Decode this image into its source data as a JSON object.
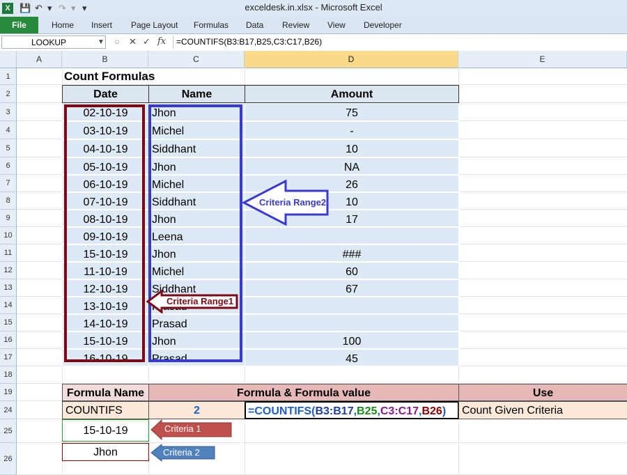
{
  "window": {
    "title": "exceldesk.in.xlsx  -  Microsoft Excel"
  },
  "ribbon": {
    "file": "File",
    "tabs": [
      "Home",
      "Insert",
      "Page Layout",
      "Formulas",
      "Data",
      "Review",
      "View",
      "Developer"
    ]
  },
  "formula_bar": {
    "name_box": "LOOKUP",
    "fx": "fx",
    "formula": "=COUNTIFS(B3:B17,B25,C3:C17,B26)"
  },
  "columns": [
    "A",
    "B",
    "C",
    "D",
    "E"
  ],
  "rows": [
    "1",
    "2",
    "3",
    "4",
    "5",
    "6",
    "7",
    "8",
    "9",
    "10",
    "11",
    "12",
    "13",
    "14",
    "15",
    "16",
    "17",
    "18",
    "19",
    "24",
    "25",
    "26"
  ],
  "sheet": {
    "title": "Count Formulas",
    "headers": {
      "date": "Date",
      "name": "Name",
      "amount": "Amount"
    },
    "records": [
      {
        "date": "02-10-19",
        "name": "Jhon",
        "amount": "75"
      },
      {
        "date": "03-10-19",
        "name": "Michel",
        "amount": "-"
      },
      {
        "date": "04-10-19",
        "name": "Siddhant",
        "amount": "10"
      },
      {
        "date": "05-10-19",
        "name": "Jhon",
        "amount": "NA"
      },
      {
        "date": "06-10-19",
        "name": "Michel",
        "amount": "26"
      },
      {
        "date": "07-10-19",
        "name": "Siddhant",
        "amount": "10"
      },
      {
        "date": "08-10-19",
        "name": "Jhon",
        "amount": "17"
      },
      {
        "date": "09-10-19",
        "name": "Leena",
        "amount": ""
      },
      {
        "date": "15-10-19",
        "name": "Jhon",
        "amount": "###"
      },
      {
        "date": "11-10-19",
        "name": "Michel",
        "amount": "60"
      },
      {
        "date": "12-10-19",
        "name": "Siddhant",
        "amount": "67"
      },
      {
        "date": "13-10-19",
        "name": "Prasad",
        "amount": ""
      },
      {
        "date": "14-10-19",
        "name": "Prasad",
        "amount": ""
      },
      {
        "date": "15-10-19",
        "name": "Jhon",
        "amount": "100"
      },
      {
        "date": "16-10-19",
        "name": "Prasad",
        "amount": "45"
      }
    ],
    "summary_headers": {
      "formula_name": "Formula Name",
      "formula_value": "Formula & Formula value",
      "use": "Use"
    },
    "summary_row": {
      "name": "COUNTIFS",
      "value": "2",
      "use": "Count Given Criteria"
    },
    "formula_parts": [
      {
        "text": "=COUNTIFS(",
        "color": "#1f5fc0"
      },
      {
        "text": "B3:B17",
        "color": "#1f3fa0"
      },
      {
        "text": ",",
        "color": "#1f5fc0"
      },
      {
        "text": "B25",
        "color": "#1a8a1a"
      },
      {
        "text": ",",
        "color": "#1f5fc0"
      },
      {
        "text": "C3:C17",
        "color": "#8a1a8a"
      },
      {
        "text": ",",
        "color": "#1f5fc0"
      },
      {
        "text": "B26",
        "color": "#8a0000"
      },
      {
        "text": ")",
        "color": "#1f5fc0"
      }
    ],
    "criteria_cells": {
      "criteria1": "15-10-19",
      "criteria2": "Jhon"
    }
  },
  "annotations": {
    "range1": "Criteria Range1",
    "range2": "Criteria Range2",
    "crit1": "Criteria 1",
    "crit2": "Criteria 2"
  },
  "colors": {
    "range1": "#7b0a16",
    "range2": "#3a3ad0",
    "crit1_arrow": "#c0504d",
    "crit2_arrow": "#4f81bd",
    "file_tab": "#2a8a3b"
  }
}
